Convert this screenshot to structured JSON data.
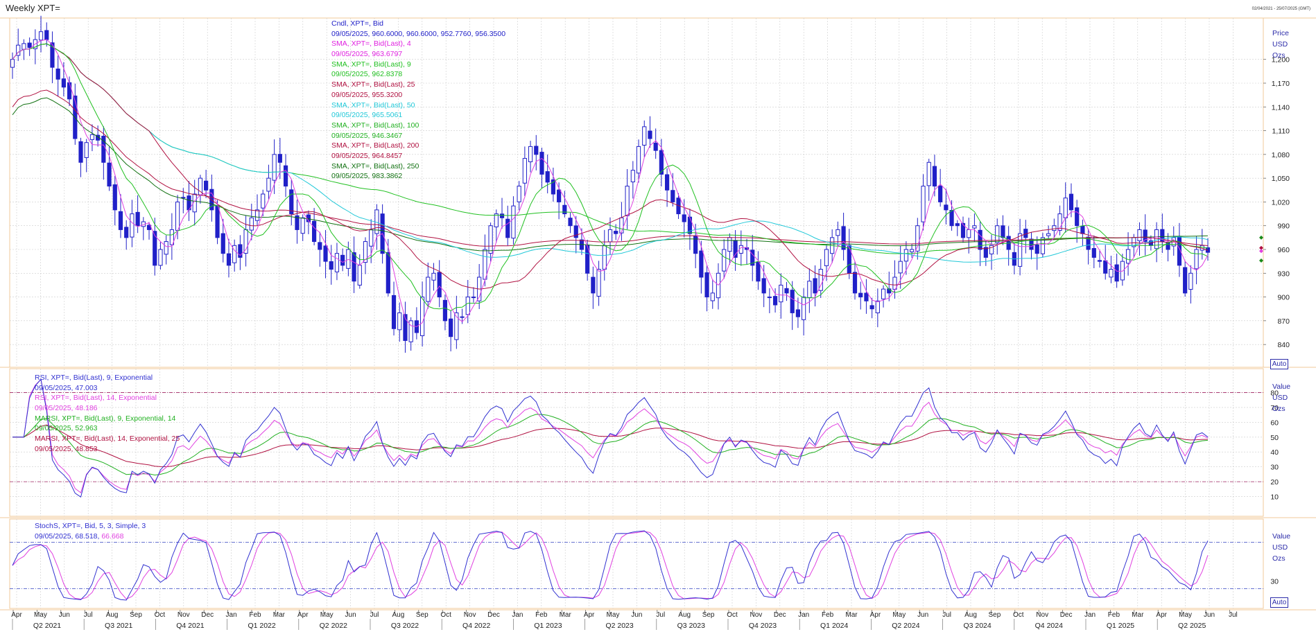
{
  "window": {
    "title": "Weekly XPT=",
    "date_range": "02/04/2021 - 25/07/2025 (GMT)"
  },
  "colors": {
    "candle": "#2020c8",
    "sma4": "#e040e0",
    "sma9": "#20c020",
    "sma25": "#b01040",
    "sma50": "#20c8d8",
    "sma100": "#20c020",
    "sma200": "#b01040",
    "sma250": "#107010",
    "rsi9": "#3030d0",
    "rsi14": "#e040e0",
    "marsi9": "#20b020",
    "marsi14": "#b01040",
    "stoch_k": "#3030d0",
    "stoch_d": "#e040e0",
    "frame": "#f0c898",
    "grid": "#cccccc",
    "axis_text": "#2a2aa8"
  },
  "legend_price": [
    {
      "label": "Cndl, XPT=, Bid",
      "value": "09/05/2025, 960.6000, 960.6000, 952.7760, 956.3500",
      "color": "#2020c8"
    },
    {
      "label": "SMA, XPT=, Bid(Last),  4",
      "value": "09/05/2025, 963.6797",
      "color": "#e020e0"
    },
    {
      "label": "SMA, XPT=, Bid(Last),  9",
      "value": "09/05/2025, 962.8378",
      "color": "#20c020"
    },
    {
      "label": "SMA, XPT=, Bid(Last),  25",
      "value": "09/05/2025, 955.3200",
      "color": "#b01040"
    },
    {
      "label": "SMA, XPT=, Bid(Last),  50",
      "value": "09/05/2025, 965.5061",
      "color": "#20c8d8"
    },
    {
      "label": "SMA, XPT=, Bid(Last),  100",
      "value": "09/05/2025, 946.3467",
      "color": "#20b020"
    },
    {
      "label": "SMA, XPT=, Bid(Last),  200",
      "value": "09/05/2025, 964.8457",
      "color": "#b01040"
    },
    {
      "label": "SMA, XPT=, Bid(Last),  250",
      "value": "09/05/2025, 983.3862",
      "color": "#107010"
    }
  ],
  "legend_rsi": [
    {
      "label": "RSI, XPT=, Bid(Last),  9, Exponential",
      "value": "09/05/2025, 47.003",
      "color": "#3030d0"
    },
    {
      "label": "RSI, XPT=, Bid(Last),  14, Exponential",
      "value": "09/05/2025, 48.186",
      "color": "#e040e0"
    },
    {
      "label": "MARSI, XPT=, Bid(Last),  9, Exponential, 14",
      "value": "09/05/2025, 52.963",
      "color": "#20b020"
    },
    {
      "label": "MARSI, XPT=, Bid(Last),  14, Exponential, 25",
      "value": "09/05/2025, 48.853",
      "color": "#b01040"
    }
  ],
  "legend_stoch": {
    "label": "StochS, XPT=, Bid,  5, 3, Simple, 3",
    "value_prefix": "09/05/2025, 68.518, ",
    "value_suffix": "66.668"
  },
  "axis_units": {
    "price": [
      "Price",
      "USD",
      "Ozs"
    ],
    "rsi": [
      "Value",
      "USD",
      "Ozs"
    ],
    "stoch": [
      "Value",
      "USD",
      "Ozs"
    ],
    "auto_label": "Auto"
  },
  "chart_data": [
    {
      "type": "candlestick",
      "panel": "price",
      "ylim": [
        820,
        1240
      ],
      "yticks": [
        840,
        870,
        900,
        930,
        960,
        990,
        1020,
        1050,
        1080,
        1110,
        1140,
        1170,
        1200
      ],
      "ytick_labels": [
        "840",
        "870",
        "900",
        "930",
        "960",
        "990",
        "1,020",
        "1,050",
        "1,080",
        "1,110",
        "1,140",
        "1,170",
        "1,200"
      ],
      "x_start": "2021-04-02",
      "x_end": "2025-07-25",
      "weekly_close_approx": [
        1200,
        1218,
        1220,
        1215,
        1225,
        1235,
        1225,
        1190,
        1175,
        1165,
        1150,
        1100,
        1070,
        1095,
        1105,
        1098,
        1070,
        1040,
        1010,
        985,
        975,
        1005,
        990,
        995,
        985,
        940,
        960,
        970,
        985,
        1020,
        1025,
        1010,
        1030,
        1050,
        1035,
        1010,
        975,
        955,
        940,
        965,
        950,
        985,
        1000,
        1010,
        1030,
        1050,
        1080,
        1070,
        1040,
        1005,
        985,
        1000,
        995,
        970,
        960,
        945,
        935,
        955,
        940,
        960,
        920,
        940,
        970,
        985,
        1010,
        955,
        905,
        860,
        880,
        845,
        870,
        855,
        900,
        925,
        930,
        900,
        870,
        850,
        880,
        875,
        900,
        900,
        925,
        960,
        990,
        1005,
        1000,
        975,
        1015,
        1040,
        1075,
        1090,
        1080,
        1055,
        1045,
        1030,
        1020,
        1005,
        990,
        975,
        960,
        930,
        905,
        935,
        965,
        985,
        980,
        1000,
        1040,
        1060,
        1090,
        1115,
        1100,
        1085,
        1055,
        1035,
        1020,
        1005,
        995,
        980,
        955,
        925,
        900,
        905,
        930,
        960,
        975,
        950,
        965,
        960,
        940,
        920,
        905,
        900,
        890,
        915,
        905,
        880,
        875,
        900,
        920,
        905,
        935,
        960,
        975,
        985,
        960,
        930,
        905,
        900,
        895,
        885,
        895,
        910,
        905,
        925,
        945,
        960,
        960,
        990,
        1040,
        1070,
        1040,
        1020,
        1010,
        990,
        990,
        975,
        985,
        990,
        960,
        950,
        965,
        990,
        975,
        960,
        940,
        980,
        975,
        960,
        955,
        975,
        980,
        990,
        1005,
        1025,
        1010,
        990,
        980,
        960,
        950,
        945,
        930,
        935,
        920,
        945,
        960,
        975,
        985,
        970,
        965,
        985,
        970,
        960,
        975,
        940,
        905,
        930,
        960,
        965,
        956.35
      ],
      "sma_last": {
        "sma4": 963.6797,
        "sma9": 962.8378,
        "sma25": 955.32,
        "sma50": 965.5061,
        "sma100": 946.3467,
        "sma200": 964.8457,
        "sma250": 983.3862
      }
    },
    {
      "type": "line",
      "panel": "rsi",
      "ylim": [
        0,
        90
      ],
      "yticks": [
        10,
        20,
        30,
        40,
        50,
        60,
        70,
        80
      ],
      "reference_lines": [
        20,
        80
      ],
      "series": [
        {
          "name": "RSI, XPT=, Bid(Last),  9, Exponential",
          "last": 47.003
        },
        {
          "name": "RSI, XPT=, Bid(Last),  14, Exponential",
          "last": 48.186
        },
        {
          "name": "MARSI, XPT=, Bid(Last),  9, Exponential, 14",
          "last": 52.963
        },
        {
          "name": "MARSI, XPT=, Bid(Last),  14, Exponential, 25",
          "last": 48.853
        }
      ]
    },
    {
      "type": "line",
      "panel": "stochastic",
      "ylim": [
        0,
        100
      ],
      "yticks": [
        30
      ],
      "reference_lines": [
        20,
        80
      ],
      "series": [
        {
          "name": "%K",
          "last": 68.518
        },
        {
          "name": "%D",
          "last": 66.668
        }
      ]
    }
  ],
  "x_axis": {
    "months": [
      "Apr",
      "May",
      "Jun",
      "Jul",
      "Aug",
      "Sep",
      "Oct",
      "Nov",
      "Dec",
      "Jan",
      "Feb",
      "Mar",
      "Apr",
      "May",
      "Jun",
      "Jul",
      "Aug",
      "Sep",
      "Oct",
      "Nov",
      "Dec",
      "Jan",
      "Feb",
      "Mar",
      "Apr",
      "May",
      "Jun",
      "Jul",
      "Aug",
      "Sep",
      "Oct",
      "Nov",
      "Dec",
      "Jan",
      "Feb",
      "Mar",
      "Apr",
      "May",
      "Jun",
      "Jul",
      "Aug",
      "Sep",
      "Oct",
      "Nov",
      "Dec",
      "Jan",
      "Feb",
      "Mar",
      "Apr",
      "May",
      "Jun",
      "Jul"
    ],
    "quarters": [
      "Q2 2021",
      "Q3 2021",
      "Q4 2021",
      "Q1 2022",
      "Q2 2022",
      "Q3 2022",
      "Q4 2022",
      "Q1 2023",
      "Q2 2023",
      "Q3 2023",
      "Q4 2023",
      "Q1 2024",
      "Q2 2024",
      "Q3 2024",
      "Q4 2024",
      "Q1 2025",
      "Q2 2025"
    ]
  }
}
